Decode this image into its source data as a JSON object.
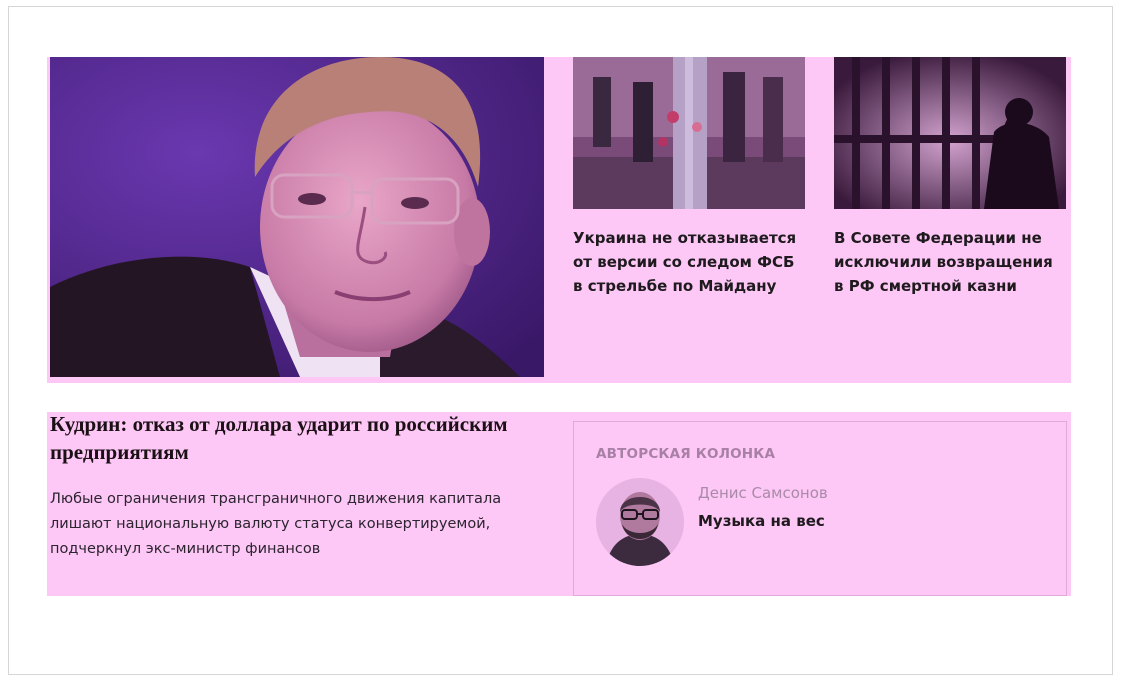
{
  "top_stories": [
    {
      "title": "Украина не отказывается от версии со следом ФСБ в стрельбе по Майдану"
    },
    {
      "title": "В Совете Федерации не исключили возвращения в РФ смертной казни"
    }
  ],
  "lead": {
    "headline": "Кудрин: отказ от доллара ударит по российским предприятиям",
    "summary": "Любые ограничения трансграничного движения капитала лишают национальную валюту статуса конвертируемой, подчеркнул экс-министр финансов"
  },
  "author_column": {
    "label": "АВТОРСКАЯ КОЛОНКА",
    "author": "Денис Самсонов",
    "title": "Музыка на вес"
  },
  "colors": {
    "highlight": "#fdc7f6",
    "photo_purple": "#4a2188"
  }
}
